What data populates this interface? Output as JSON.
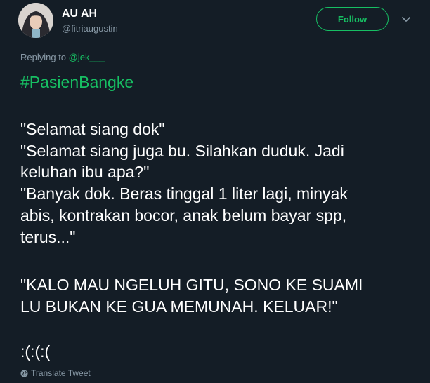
{
  "user": {
    "display_name": "AU AH",
    "handle": "@fitriaugustin"
  },
  "follow_label": "Follow",
  "reply": {
    "prefix": "Replying to ",
    "mention": "@jek___"
  },
  "tweet": {
    "hashtag": "#PasienBangke",
    "lines": [
      "\"Selamat siang dok\"",
      "\"Selamat siang juga bu. Silahkan duduk. Jadi",
      "keluhan ibu apa?\"",
      "\"Banyak dok. Beras tinggal 1 liter lagi, minyak",
      "abis, kontrakan bocor, anak belum bayar spp,",
      "terus...\"",
      "\"KALO MAU NGELUH GITU, SONO KE SUAMI",
      "LU BUKAN KE GUA MEMUNAH. KELUAR!\"",
      ":(:(:("
    ]
  },
  "translate_label": "Translate Tweet",
  "colors": {
    "background": "#141d26",
    "accent": "#17bf63",
    "muted": "#8899a6",
    "text": "#ffffff"
  },
  "icons": {
    "menu": "chevron-down-icon",
    "translate": "globe-icon"
  }
}
